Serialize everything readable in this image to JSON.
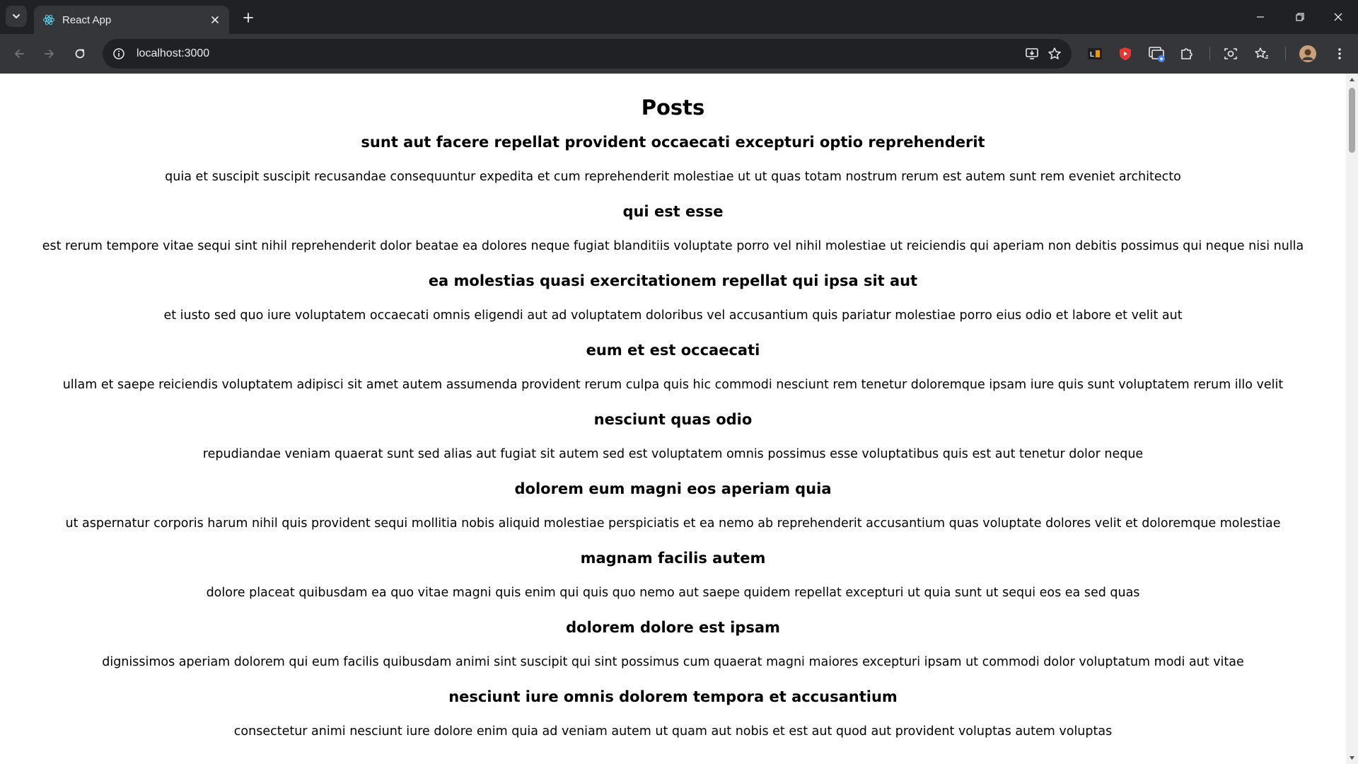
{
  "browser": {
    "tab": {
      "title": "React App"
    },
    "address": {
      "url": "localhost:3000"
    }
  },
  "icons": {
    "tab_search": "chevron-down-icon",
    "favicon": "react-icon",
    "tab_close": "close-icon",
    "new_tab": "plus-icon",
    "minimize": "minimize-icon",
    "restore": "restore-icon",
    "close_window": "close-icon",
    "back": "arrow-left-icon",
    "forward": "arrow-right-icon",
    "reload": "reload-icon",
    "site_info": "info-icon",
    "install": "install-app-icon",
    "bookmark": "star-icon"
  },
  "colors": {
    "tabbar_bg": "#202124",
    "toolbar_bg": "#35363a",
    "react_blue": "#61dafb"
  },
  "page": {
    "heading": "Posts",
    "posts": [
      {
        "title": "sunt aut facere repellat provident occaecati excepturi optio reprehenderit",
        "body": "quia et suscipit suscipit recusandae consequuntur expedita et cum reprehenderit molestiae ut ut quas totam nostrum rerum est autem sunt rem eveniet architecto"
      },
      {
        "title": "qui est esse",
        "body": "est rerum tempore vitae sequi sint nihil reprehenderit dolor beatae ea dolores neque fugiat blanditiis voluptate porro vel nihil molestiae ut reiciendis qui aperiam non debitis possimus qui neque nisi nulla"
      },
      {
        "title": "ea molestias quasi exercitationem repellat qui ipsa sit aut",
        "body": "et iusto sed quo iure voluptatem occaecati omnis eligendi aut ad voluptatem doloribus vel accusantium quis pariatur molestiae porro eius odio et labore et velit aut"
      },
      {
        "title": "eum et est occaecati",
        "body": "ullam et saepe reiciendis voluptatem adipisci sit amet autem assumenda provident rerum culpa quis hic commodi nesciunt rem tenetur doloremque ipsam iure quis sunt voluptatem rerum illo velit"
      },
      {
        "title": "nesciunt quas odio",
        "body": "repudiandae veniam quaerat sunt sed alias aut fugiat sit autem sed est voluptatem omnis possimus esse voluptatibus quis est aut tenetur dolor neque"
      },
      {
        "title": "dolorem eum magni eos aperiam quia",
        "body": "ut aspernatur corporis harum nihil quis provident sequi mollitia nobis aliquid molestiae perspiciatis et ea nemo ab reprehenderit accusantium quas voluptate dolores velit et doloremque molestiae"
      },
      {
        "title": "magnam facilis autem",
        "body": "dolore placeat quibusdam ea quo vitae magni quis enim qui quis quo nemo aut saepe quidem repellat excepturi ut quia sunt ut sequi eos ea sed quas"
      },
      {
        "title": "dolorem dolore est ipsam",
        "body": "dignissimos aperiam dolorem qui eum facilis quibusdam animi sint suscipit qui sint possimus cum quaerat magni maiores excepturi ipsam ut commodi dolor voluptatum modi aut vitae"
      },
      {
        "title": "nesciunt iure omnis dolorem tempora et accusantium",
        "body": "consectetur animi nesciunt iure dolore enim quia ad veniam autem ut quam aut nobis et est aut quod aut provident voluptas autem voluptas"
      }
    ]
  }
}
